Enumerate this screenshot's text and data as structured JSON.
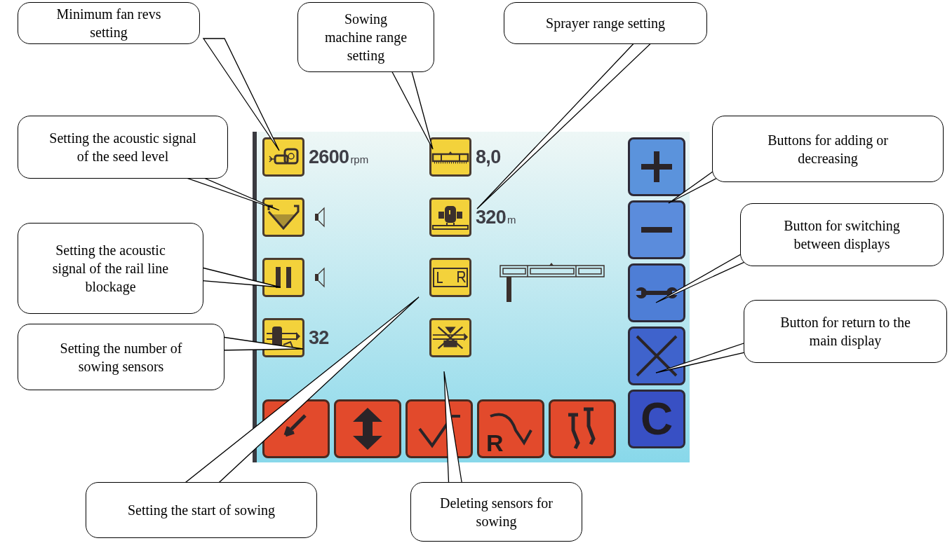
{
  "screen": {
    "rows": [
      {
        "left": {
          "kind": "reading",
          "value": "2600",
          "unit": "rpm"
        },
        "right": {
          "kind": "reading",
          "value": "8,0"
        }
      },
      {
        "left": {
          "kind": "sound"
        },
        "right": {
          "kind": "reading",
          "value": "320",
          "unit": "m"
        }
      },
      {
        "left": {
          "kind": "sound"
        },
        "right": {
          "kind": "boom"
        }
      },
      {
        "left": {
          "kind": "reading",
          "value": "32"
        },
        "right": {
          "kind": "none"
        }
      }
    ],
    "side_buttons": [
      {
        "kind": "plus"
      },
      {
        "kind": "minus"
      },
      {
        "kind": "wrench"
      },
      {
        "kind": "cross"
      },
      {
        "kind": "letter",
        "label": "C"
      }
    ],
    "bottom_buttons": [
      {
        "kind": "left"
      },
      {
        "kind": "updown"
      },
      {
        "kind": "marker"
      },
      {
        "kind": "right",
        "label": "R"
      },
      {
        "kind": "tracks"
      }
    ]
  },
  "callouts": [
    {
      "text": "Minimum fan revs setting"
    },
    {
      "text": "Sowing machine range setting"
    },
    {
      "text": "Sprayer range setting"
    },
    {
      "text": "Setting the acoustic signal of the seed level"
    },
    {
      "text": "Buttons for adding or decreasing"
    },
    {
      "text": "Setting the acoustic signal of the rail line blockage"
    },
    {
      "text": "Button for switching between displays"
    },
    {
      "text": "Button for return to the main display"
    },
    {
      "text": "Setting the number of sowing sensors"
    },
    {
      "text": "Setting the start of sowing"
    },
    {
      "text": "Deleting sensors for sowing"
    }
  ]
}
